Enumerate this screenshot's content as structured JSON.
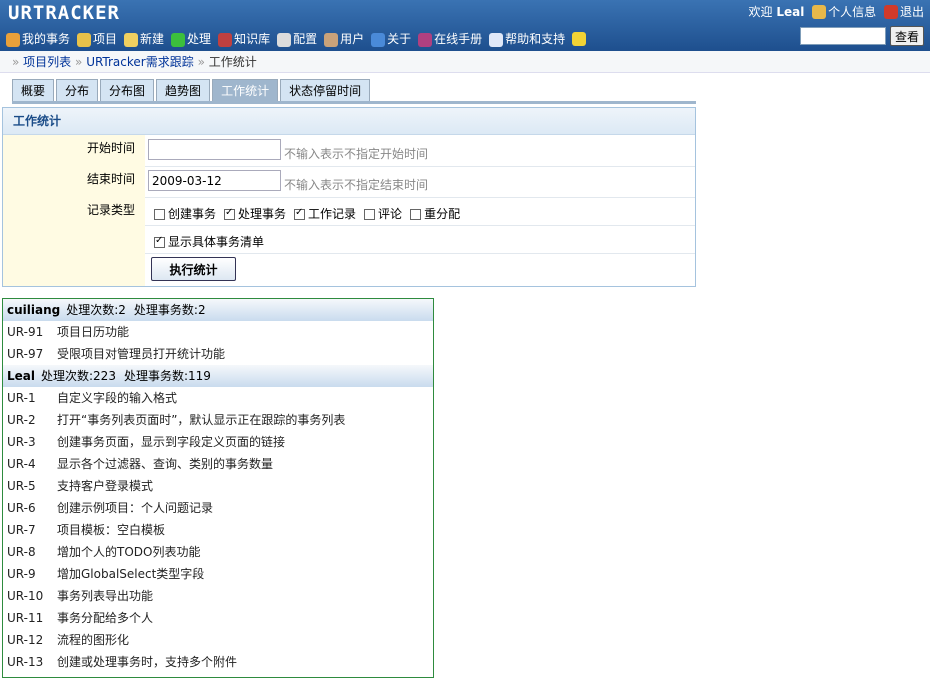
{
  "brand": {
    "logo": "URTRACKER"
  },
  "user": {
    "welcome": "欢迎",
    "name": "Leal",
    "profile": "个人信息",
    "logout": "退出"
  },
  "menu": [
    {
      "label": "我的事务",
      "icon": "home-icon",
      "color": "#e8a03a"
    },
    {
      "label": "项目",
      "icon": "database-icon",
      "color": "#e8c24a"
    },
    {
      "label": "新建",
      "icon": "new-icon",
      "color": "#f0d060"
    },
    {
      "label": "处理",
      "icon": "checkmark-icon",
      "color": "#3cbf3c"
    },
    {
      "label": "知识库",
      "icon": "books-icon",
      "color": "#c04040"
    },
    {
      "label": "配置",
      "icon": "gear-icon",
      "color": "#dcdcdc"
    },
    {
      "label": "用户",
      "icon": "users-icon",
      "color": "#c9a27a"
    },
    {
      "label": "关于",
      "icon": "info-icon",
      "color": "#4a8ad8"
    },
    {
      "label": "在线手册",
      "icon": "manual-icon",
      "color": "#b04080"
    },
    {
      "label": "帮助和支持",
      "icon": "help-icon",
      "color": "#e0e8f8"
    },
    {
      "label": "",
      "icon": "star-icon",
      "color": "#f2d335"
    }
  ],
  "search": {
    "placeholder": "",
    "button": "查看"
  },
  "breadcrumb": {
    "items": [
      "项目列表",
      "URTracker需求跟踪"
    ],
    "current": "工作统计",
    "sep": "»"
  },
  "tabs": [
    {
      "label": "概要",
      "active": false
    },
    {
      "label": "分布",
      "active": false
    },
    {
      "label": "分布图",
      "active": false
    },
    {
      "label": "趋势图",
      "active": false
    },
    {
      "label": "工作统计",
      "active": true
    },
    {
      "label": "状态停留时间",
      "active": false
    }
  ],
  "form": {
    "title": "工作统计",
    "start_label": "开始时间",
    "start_value": "",
    "start_hint": "不输入表示不指定开始时间",
    "end_label": "结束时间",
    "end_value": "2009-03-12",
    "end_hint": "不输入表示不指定结束时间",
    "type_label": "记录类型",
    "types": [
      {
        "label": "创建事务",
        "checked": false
      },
      {
        "label": "处理事务",
        "checked": true
      },
      {
        "label": "工作记录",
        "checked": true
      },
      {
        "label": "评论",
        "checked": false
      },
      {
        "label": "重分配",
        "checked": false
      }
    ],
    "detail_label": "显示具体事务清单",
    "detail_checked": true,
    "run_button": "执行统计"
  },
  "results": [
    {
      "user": "cuiliang",
      "count_text": "处理次数:2",
      "items_text": "处理事务数:2",
      "rows": [
        {
          "id": "UR-91",
          "title": "项目日历功能"
        },
        {
          "id": "UR-97",
          "title": "受限项目对管理员打开统计功能"
        }
      ]
    },
    {
      "user": "Leal",
      "count_text": "处理次数:223",
      "items_text": "处理事务数:119",
      "rows": [
        {
          "id": "UR-1",
          "title": "自定义字段的输入格式"
        },
        {
          "id": "UR-2",
          "title": "打开“事务列表页面时”，默认显示正在跟踪的事务列表"
        },
        {
          "id": "UR-3",
          "title": "创建事务页面，显示到字段定义页面的链接"
        },
        {
          "id": "UR-4",
          "title": "显示各个过滤器、查询、类别的事务数量"
        },
        {
          "id": "UR-5",
          "title": "支持客户登录模式"
        },
        {
          "id": "UR-6",
          "title": "创建示例项目：个人问题记录"
        },
        {
          "id": "UR-7",
          "title": "项目模板：空白模板"
        },
        {
          "id": "UR-8",
          "title": "增加个人的TODO列表功能"
        },
        {
          "id": "UR-9",
          "title": "增加GlobalSelect类型字段"
        },
        {
          "id": "UR-10",
          "title": "事务列表导出功能"
        },
        {
          "id": "UR-11",
          "title": "事务分配给多个人"
        },
        {
          "id": "UR-12",
          "title": "流程的图形化"
        },
        {
          "id": "UR-13",
          "title": "创建或处理事务时，支持多个附件"
        }
      ]
    }
  ]
}
